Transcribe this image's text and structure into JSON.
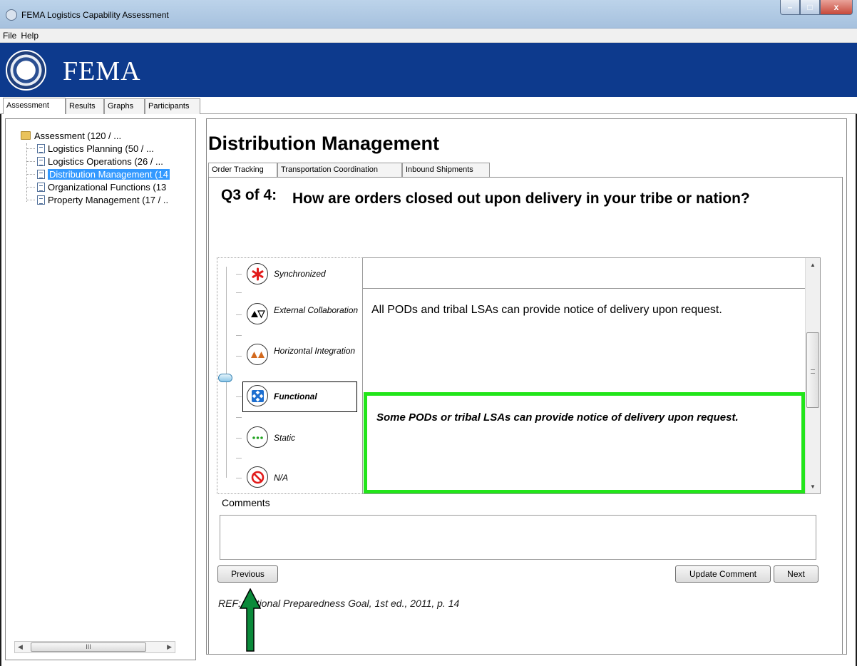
{
  "window": {
    "title": "FEMA Logistics Capability Assessment",
    "controls": {
      "minimize": "–",
      "maximize": "□",
      "close": "x"
    }
  },
  "menu": {
    "items": [
      "File",
      "Help"
    ]
  },
  "banner": {
    "brand": "FEMA",
    "seal_icon": "dhs-seal-icon",
    "bg_color": "#0d3a8d"
  },
  "main_tabs": [
    {
      "label": "Assessment",
      "active": true
    },
    {
      "label": "Results",
      "active": false
    },
    {
      "label": "Graphs",
      "active": false
    },
    {
      "label": "Participants",
      "active": false
    }
  ],
  "tree": {
    "root": "Assessment (120 / ...",
    "children": [
      {
        "label": "Logistics Planning (50 / ...",
        "selected": false
      },
      {
        "label": "Logistics Operations (26 / ...",
        "selected": false
      },
      {
        "label": "Distribution Management (14",
        "selected": true
      },
      {
        "label": "Organizational Functions (13",
        "selected": false
      },
      {
        "label": "Property Management (17 / ..",
        "selected": false
      }
    ],
    "scroll_thumb": "III"
  },
  "content": {
    "title": "Distribution Management",
    "sub_tabs": [
      {
        "label": "Order Tracking",
        "active": true
      },
      {
        "label": "Transportation Coordination",
        "active": false
      },
      {
        "label": "Inbound Shipments",
        "active": false
      }
    ],
    "question_number": "Q3 of 4:",
    "question_text": "How are orders closed out upon delivery in your tribe or nation?",
    "levels": [
      {
        "label": "Synchronized",
        "icon": "asterisk-icon",
        "color": "#e21b1b"
      },
      {
        "label": "External Collaboration",
        "icon": "triangles-icon",
        "color": "#000000"
      },
      {
        "label": "Horizontal Integration",
        "icon": "orange-triangles-icon",
        "color": "#d2691e"
      },
      {
        "label": "Functional",
        "icon": "diamond-icon",
        "color": "#1e6fd0",
        "selected": true
      },
      {
        "label": "Static",
        "icon": "dots-icon",
        "color": "#22a322"
      },
      {
        "label": "N/A",
        "icon": "prohibited-icon",
        "color": "#e21b1b"
      }
    ],
    "descriptions": {
      "external_collaboration": "All PODs and tribal LSAs can provide notice of delivery upon request.",
      "functional": "Some PODs or tribal LSAs can provide notice of delivery upon request."
    },
    "selected_highlight_color": "#22e51a",
    "comments_label": "Comments",
    "comments_value": "",
    "buttons": {
      "previous": "Previous",
      "update_comment": "Update Comment",
      "next": "Next"
    },
    "reference": "REF: National Preparedness Goal, 1st ed., 2011, p. 14",
    "annotation_arrow_color": "#0b8a3a"
  }
}
